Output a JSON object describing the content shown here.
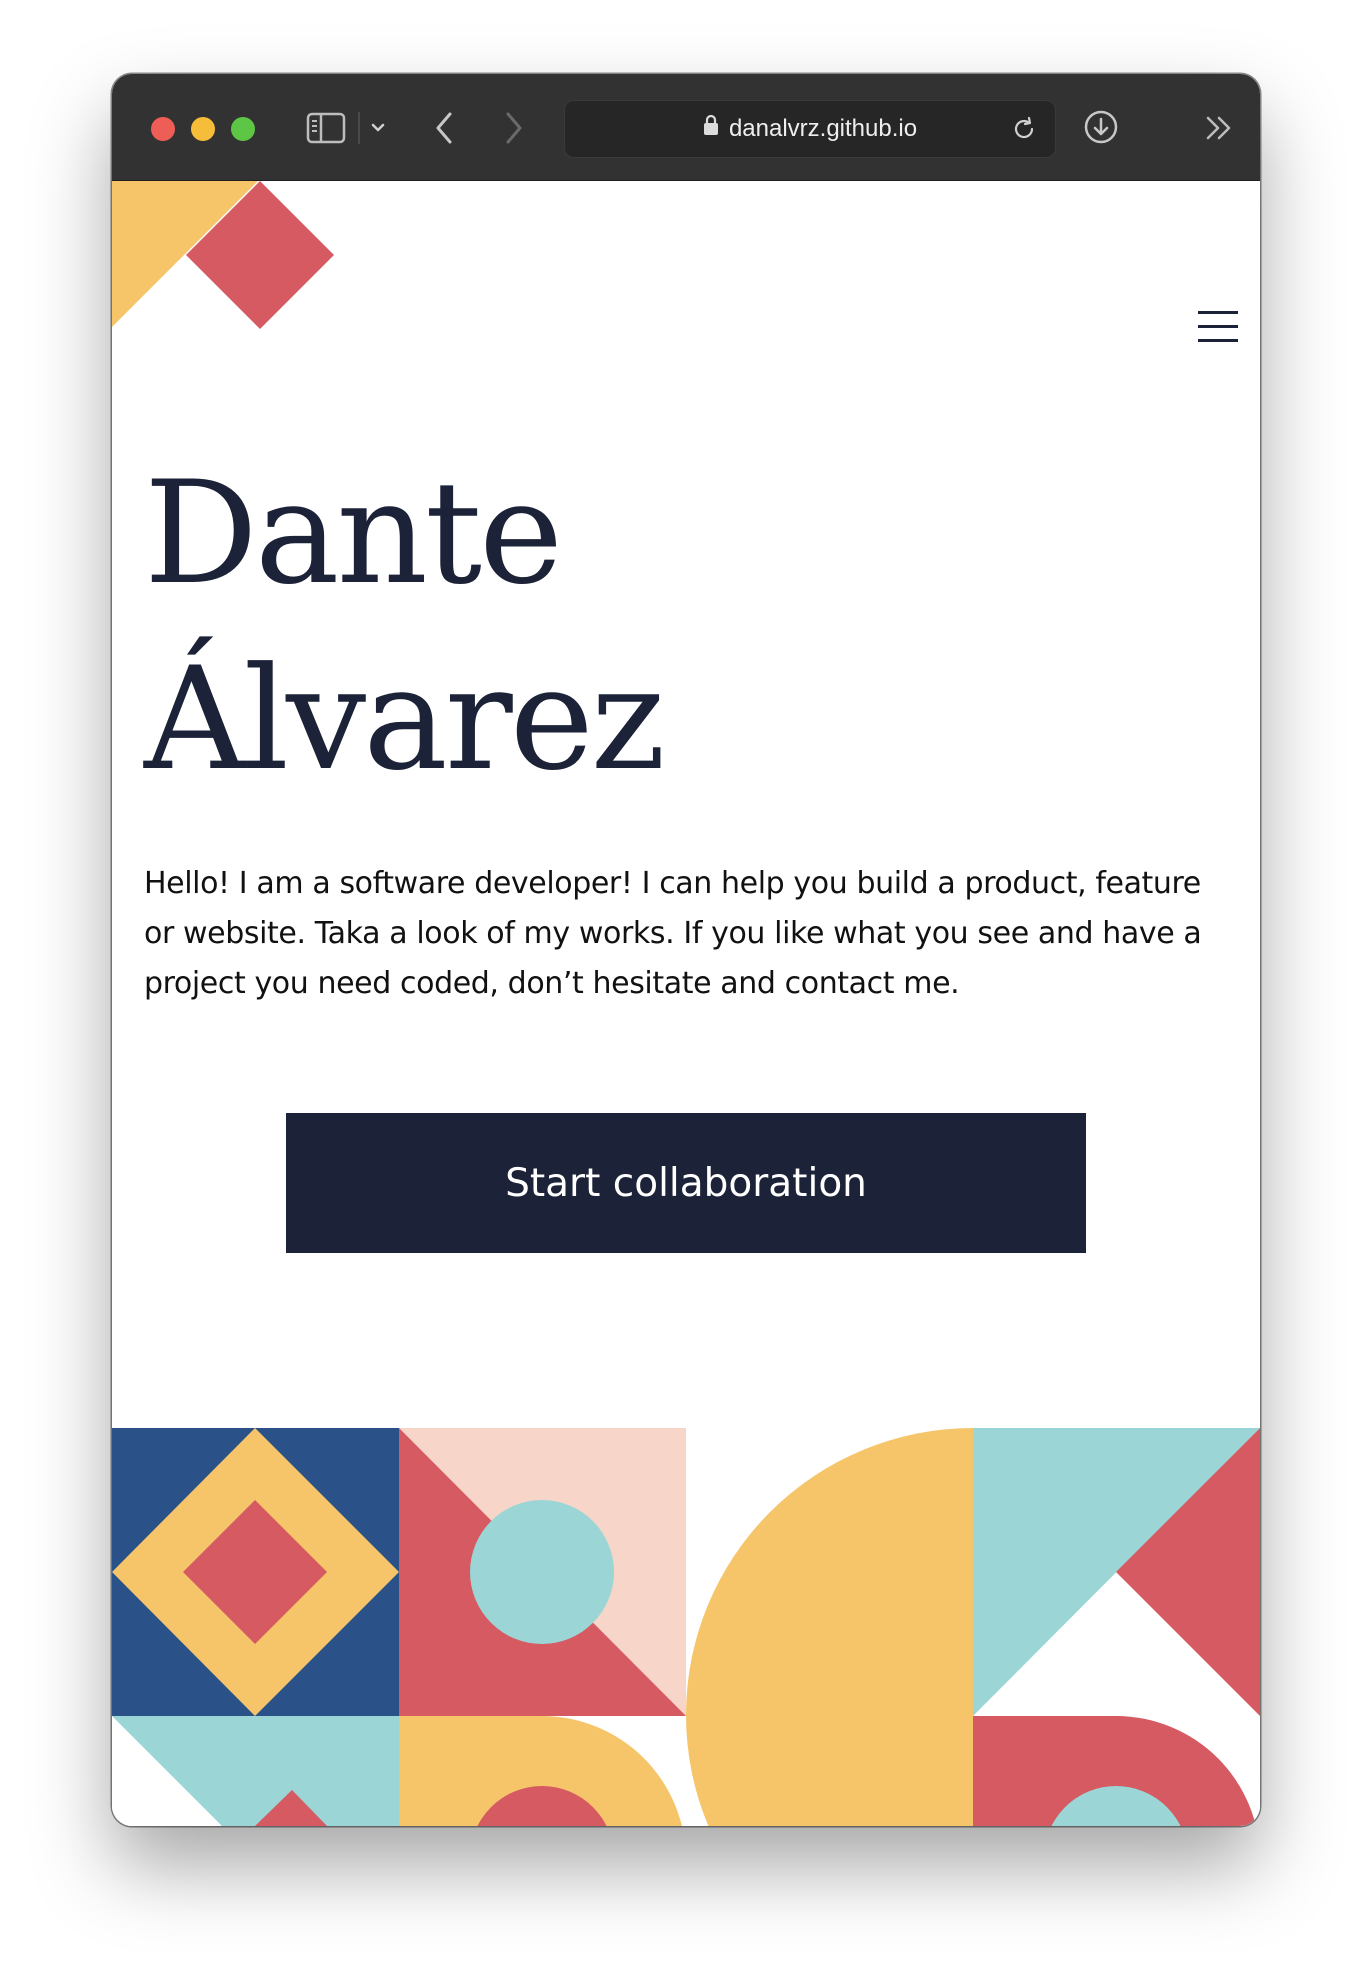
{
  "browser": {
    "url": "danalvrz.github.io",
    "icons": [
      "sidebar-toggle-icon",
      "chevron-down-icon",
      "back-icon",
      "forward-icon",
      "lock-icon",
      "reload-icon",
      "download-icon",
      "more-icon"
    ]
  },
  "hero": {
    "title_line1": "Dante",
    "title_line2": "Álvarez",
    "intro": "Hello! I am a software developer! I can help you build a product, feature or website. Taka a look of my works. If you like what you see and have a project you need coded, don’t hesitate and contact me.",
    "cta_label": "Start collaboration"
  },
  "nav": {
    "menu_icon": "hamburger-menu-icon"
  },
  "colors": {
    "navy": "#1c2237",
    "blue": "#2a5288",
    "yellow": "#f6c56a",
    "red": "#d65a61",
    "teal": "#9bd5d6",
    "peach": "#f7d5c8"
  }
}
